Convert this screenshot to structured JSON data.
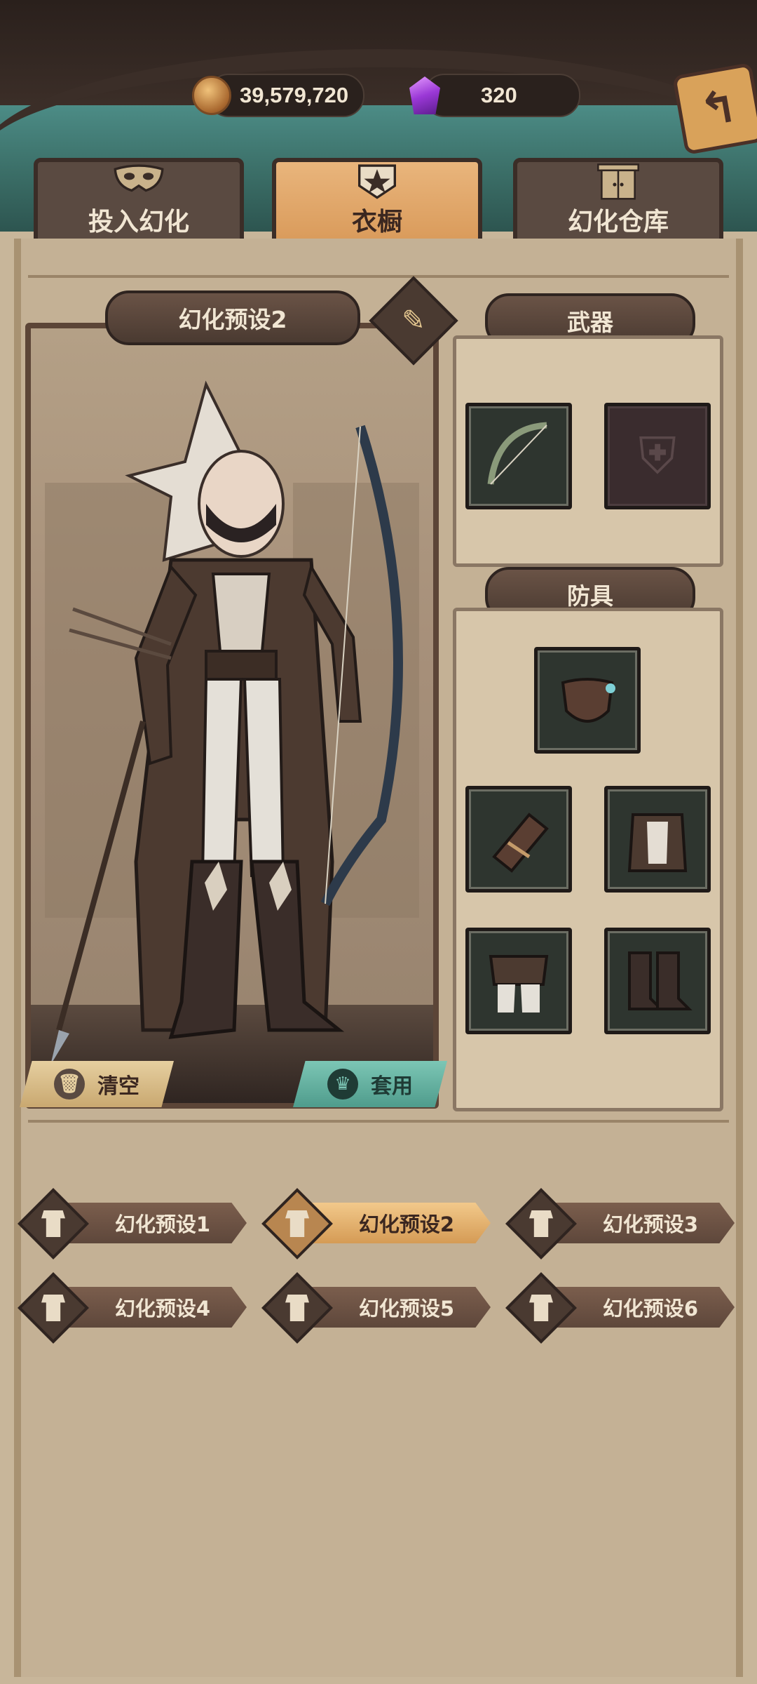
{
  "currencies": {
    "coins": {
      "icon": "coin-icon",
      "value": "39,579,720"
    },
    "gems": {
      "icon": "gem-icon",
      "value": "320"
    }
  },
  "tabs": [
    {
      "label": "投入幻化",
      "icon": "mask-icon",
      "active": false
    },
    {
      "label": "衣橱",
      "icon": "wardrobe-crest-icon",
      "active": true
    },
    {
      "label": "幻化仓库",
      "icon": "cabinet-icon",
      "active": false
    }
  ],
  "preview": {
    "title": "幻化预设2",
    "clear_label": "清空",
    "apply_label": "套用"
  },
  "weapon_section": {
    "title": "武器",
    "slots": [
      {
        "icon": "bow-icon",
        "filled": true
      },
      {
        "icon": "empty-shield-icon",
        "filled": false
      }
    ]
  },
  "armor_section": {
    "title": "防具",
    "slots": [
      {
        "icon": "mask-item-icon",
        "filled": true
      },
      {
        "icon": "bracer-icon",
        "filled": true
      },
      {
        "icon": "chest-armor-icon",
        "filled": true
      },
      {
        "icon": "leggings-icon",
        "filled": true
      },
      {
        "icon": "boots-icon",
        "filled": true
      }
    ]
  },
  "presets": [
    {
      "label": "幻化预设1",
      "active": false
    },
    {
      "label": "幻化预设2",
      "active": true
    },
    {
      "label": "幻化预设3",
      "active": false
    },
    {
      "label": "幻化预设4",
      "active": false
    },
    {
      "label": "幻化预设5",
      "active": false
    },
    {
      "label": "幻化预设6",
      "active": false
    }
  ],
  "colors": {
    "active_tab": "#e9b57c",
    "apply_button": "#6ab5a4",
    "panel_bg": "#c4b195"
  }
}
